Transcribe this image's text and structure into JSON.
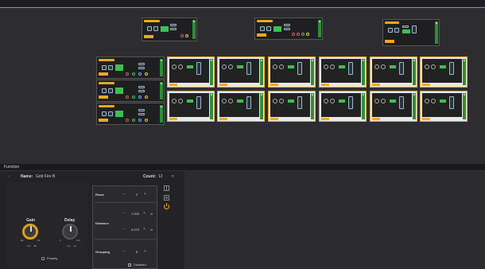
{
  "function_panel": {
    "title": "Function",
    "name_label": "Name",
    "name_value": "Grid Fire B",
    "count_label": "Count",
    "count_value": "12",
    "close_glyph": "✕",
    "collapse_glyph": "‹"
  },
  "knobs": {
    "gain": {
      "label": "Gain",
      "min": "-80",
      "max": "18",
      "value": "0.0",
      "unit": "dB"
    },
    "delay": {
      "label": "Delay",
      "min": "0",
      "max": "100",
      "value": "0.0",
      "unit": "ms"
    }
  },
  "polarity_label": "Polarity",
  "params": {
    "rows": {
      "label": "Rows",
      "value": "2"
    },
    "distance_label": "Distance",
    "distance_a": {
      "value": "1.200",
      "unit": "m"
    },
    "distance_b": {
      "value": "4.270",
      "unit": "m"
    },
    "grouping": {
      "label": "Grouping",
      "value": "6"
    },
    "disabled_label": "Disabled",
    "minus": "−",
    "plus": "+"
  },
  "colors": {
    "accent": "#f0a81e",
    "canvas": "#2d2d30",
    "panel": "#232325",
    "status_green": "#3fbf52"
  },
  "icons": [
    "grid-icon",
    "monitor-icon",
    "power-icon"
  ]
}
